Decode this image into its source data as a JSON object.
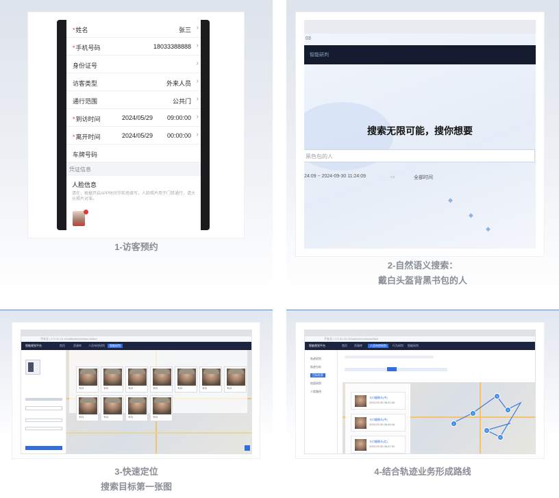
{
  "panel1": {
    "caption": "1-访客预约",
    "fields": [
      {
        "label": "姓名",
        "required": true,
        "value": "张三"
      },
      {
        "label": "手机号码",
        "required": true,
        "value": "18033388888"
      },
      {
        "label": "身份证号",
        "required": false,
        "value": ""
      },
      {
        "label": "访客类型",
        "required": false,
        "value": "外来人员"
      },
      {
        "label": "通行范围",
        "required": false,
        "value": "公共门"
      },
      {
        "label": "到访时间",
        "required": true,
        "date": "2024/05/29",
        "time": "09:00:00"
      },
      {
        "label": "离开时间",
        "required": true,
        "date": "2024/05/29",
        "time": "00:00:00"
      },
      {
        "label": "车牌号码",
        "required": false,
        "value": ""
      }
    ],
    "section_label": "凭证信息",
    "face_title": "人脸信息",
    "face_desc": "请在，根据开启APP时间节前场填写，人脸照片用于门禁通行，请大头照片对准。"
  },
  "panel2": {
    "caption_line1": "2-自然语义搜索：",
    "caption_line2": "戴白头盔背黑书包的人",
    "page_num": "03",
    "nav_title": "智能研判",
    "hero": "搜索无限可能，搜你想要",
    "search_text": "黑色包的人",
    "date_range": "24:09  ~  2024-09-30 11:24:09",
    "time_label": "全部时间"
  },
  "panel3": {
    "caption_line1": "3-快速定位",
    "caption_line2": "搜索目标第一张图",
    "address": "不安全 | 172.20.15.15/sdkt/client/#/search/face",
    "app_name": "智能视觉平台",
    "nav": [
      "首页",
      "资源库",
      "人员布控研判",
      "智能研判"
    ],
    "thumb_label": "卡口",
    "thumb_count": 11
  },
  "panel4": {
    "caption": "4-结合轨迹业务形成路线",
    "address": "不安全 | 172.20.15.15/sdkt/client/#/track/face",
    "app_name": "智能视觉平台",
    "nav": [
      "首页",
      "资源库",
      "人员布控研判",
      "行为研判",
      "智能研判"
    ],
    "side_items": [
      "轨迹研判",
      "轨迹分析",
      "目标检索",
      "档案研判",
      "人脸路径"
    ],
    "list_items": [
      {
        "title": "卡口摄像头(中)",
        "time": "2024-09-30 08:32:06"
      },
      {
        "title": "卡口摄像头(中)",
        "time": "2024-09-30 08:40:16"
      },
      {
        "title": "卡口摄像头(北)",
        "time": "2024-09-30 08:47:01"
      }
    ],
    "nodes": [
      "1",
      "2",
      "3",
      "4",
      "5",
      "6"
    ]
  },
  "colors": {
    "accent": "#2f6de0",
    "required": "#e03a3a",
    "caption": "#8a8f96",
    "dark_nav": "#141b2e"
  }
}
